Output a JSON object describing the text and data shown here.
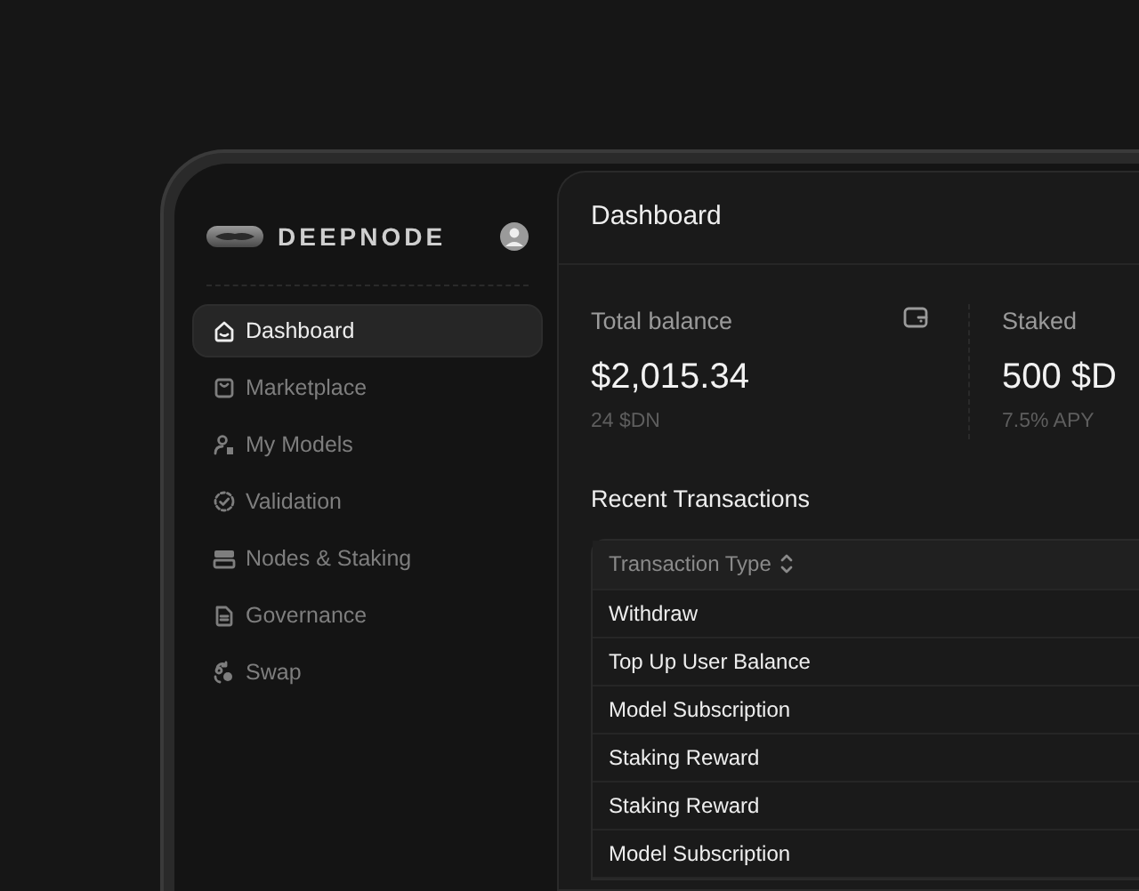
{
  "brand": {
    "name": "DEEPNODE"
  },
  "sidebar": {
    "items": [
      {
        "label": "Dashboard",
        "selected": true
      },
      {
        "label": "Marketplace",
        "selected": false
      },
      {
        "label": "My Models",
        "selected": false
      },
      {
        "label": "Validation",
        "selected": false
      },
      {
        "label": "Nodes & Staking",
        "selected": false
      },
      {
        "label": "Governance",
        "selected": false
      },
      {
        "label": "Swap",
        "selected": false
      }
    ]
  },
  "header": {
    "title": "Dashboard"
  },
  "stats": [
    {
      "label": "Total balance",
      "value": "$2,015.34",
      "sub": "24 $DN"
    },
    {
      "label": "Staked",
      "value": "500 $D",
      "sub": "7.5% APY"
    }
  ],
  "transactions": {
    "title": "Recent Transactions",
    "columns": [
      "Transaction Type"
    ],
    "rows": [
      "Withdraw",
      "Top Up User Balance",
      "Model Subscription",
      "Staking Reward",
      "Staking Reward",
      "Model Subscription"
    ]
  }
}
